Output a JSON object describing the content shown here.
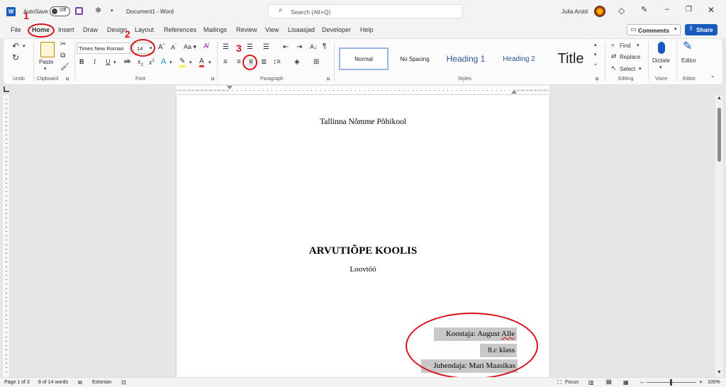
{
  "titlebar": {
    "autosave_label": "AutoSave",
    "autosave_state": "Off",
    "doc_title": "Document1  -  Word",
    "search_placeholder": "Search (Alt+Q)",
    "user_name": "Julia Arold"
  },
  "menu": {
    "items": [
      "File",
      "Home",
      "Insert",
      "Draw",
      "Design",
      "Layout",
      "References",
      "Mailings",
      "Review",
      "View",
      "Lisaasjad",
      "Developer",
      "Help"
    ],
    "comments_label": "Comments",
    "share_label": "Share"
  },
  "ribbon": {
    "groups": {
      "undo": "Undo",
      "clipboard": "Clipboard",
      "font": "Font",
      "paragraph": "Paragraph",
      "styles": "Styles",
      "editing": "Editing",
      "voice": "Voice",
      "editor": "Editor"
    },
    "paste_label": "Paste",
    "font_name": "Times New Roman",
    "font_size": "14",
    "styles": [
      "Normal",
      "No Spacing",
      "Heading 1",
      "Heading 2",
      "Title"
    ],
    "find_label": "Find",
    "replace_label": "Replace",
    "select_label": "Select",
    "dictate_label": "Dictate",
    "editor_label": "Editor"
  },
  "annotations": {
    "one": "1",
    "two": "2",
    "three": "3"
  },
  "document": {
    "school": "Tallinna Nõmme Põhikool",
    "title": "ARVUTIÕPE KOOLIS",
    "subtitle": "Loovtöö",
    "author": "Koostaja: August Alle",
    "class": "8.c klass",
    "supervisor": "Juhendaja: Mari Maasikas"
  },
  "status": {
    "page": "Page 1 of 3",
    "words": "8 of 14 words",
    "language": "Estonian",
    "focus": "Focus",
    "zoom": "100%"
  },
  "colors": {
    "word_blue": "#185abd",
    "annotation_red": "#d7111b"
  }
}
